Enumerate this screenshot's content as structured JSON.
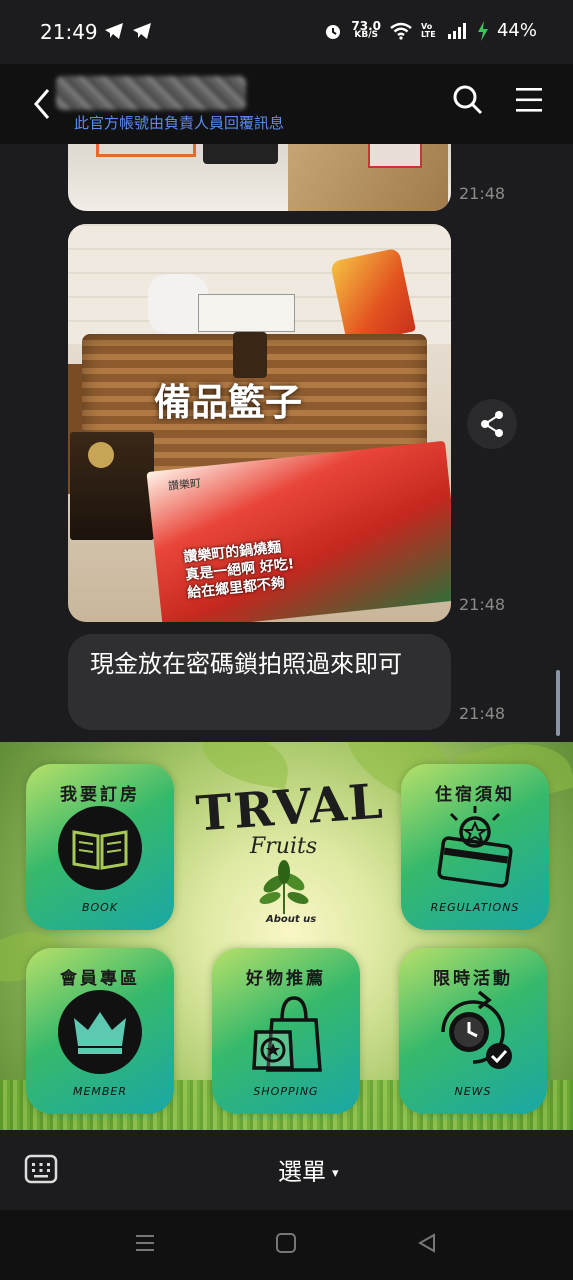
{
  "status_bar": {
    "time": "21:49",
    "net_speed_value": "73.0",
    "net_speed_unit": "KB/S",
    "volte": "Vo LTE",
    "battery": "44%",
    "icons": [
      "telegram-icon",
      "telegram-icon",
      "alarm-icon",
      "wifi-icon",
      "signal-icon",
      "charging-icon"
    ]
  },
  "header": {
    "subtitle": "此官方帳號由負責人員回覆訊息",
    "icons": [
      "back-icon",
      "search-icon",
      "menu-icon"
    ]
  },
  "chat": {
    "messages": [
      {
        "type": "image",
        "time": "21:48"
      },
      {
        "type": "image",
        "overlay_text": "備品籃子",
        "flyer_brand": "讚樂町",
        "flyer_lines": [
          "讚樂町的鍋燒麵",
          "真是一絕啊 好吃!",
          "給在鄉里都不夠"
        ],
        "time": "21:48"
      },
      {
        "type": "text",
        "text": "現金放在密碼鎖拍照過來即可",
        "time": "21:48"
      }
    ]
  },
  "rich_menu": {
    "brand_title": "TRVAL",
    "brand_subtitle": "Fruits",
    "brand_about": "About us",
    "tiles": [
      {
        "title": "我要訂房",
        "subtitle": "BOOK",
        "icon": "book-icon"
      },
      {
        "title": "住宿須知",
        "subtitle": "REGULATIONS",
        "icon": "card-star-icon"
      },
      {
        "title": "會員專區",
        "subtitle": "MEMBER",
        "icon": "crown-icon"
      },
      {
        "title": "好物推薦",
        "subtitle": "SHOPPING",
        "icon": "shopping-bag-icon"
      },
      {
        "title": "限時活動",
        "subtitle": "NEWS",
        "icon": "clock-check-icon"
      }
    ],
    "colors": {
      "tile_start": "#b7e06a",
      "tile_mid": "#37b96b",
      "tile_end": "#1aa7a5"
    }
  },
  "bottom_bar": {
    "menu_label": "選單",
    "caret": "▾"
  },
  "colors": {
    "background": "#1c1c1e",
    "header": "#111111",
    "link_blue": "#5a8cf0",
    "bubble": "#2f2f31"
  }
}
